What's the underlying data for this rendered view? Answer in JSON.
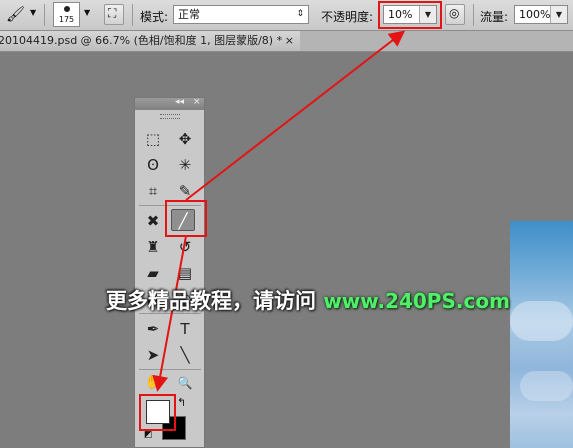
{
  "options_bar": {
    "brush_size": "175",
    "mode_label": "模式:",
    "mode_value": "正常",
    "opacity_label": "不透明度:",
    "opacity_value": "10%",
    "flow_label": "流量:",
    "flow_value": "100%"
  },
  "document_tab": {
    "title": "20104419.psd @ 66.7% (色相/饱和度 1, 图层蒙版/8) *",
    "close": "×"
  },
  "tools_panel": {
    "collapse": "◂◂",
    "close": "×",
    "tools": [
      {
        "name": "marquee",
        "glyph": "⬚"
      },
      {
        "name": "move",
        "glyph": "✥"
      },
      {
        "name": "lasso",
        "glyph": "ʘ"
      },
      {
        "name": "magic-wand",
        "glyph": "✳"
      },
      {
        "name": "crop",
        "glyph": "⌗"
      },
      {
        "name": "eyedropper",
        "glyph": "✎"
      },
      {
        "name": "healing",
        "glyph": "✖"
      },
      {
        "name": "brush",
        "glyph": "╱"
      },
      {
        "name": "stamp",
        "glyph": "♜"
      },
      {
        "name": "history-brush",
        "glyph": "↺"
      },
      {
        "name": "eraser",
        "glyph": "▰"
      },
      {
        "name": "gradient",
        "glyph": "▤"
      },
      {
        "name": "dodge",
        "glyph": "●"
      },
      {
        "name": "blur",
        "glyph": "◐"
      },
      {
        "name": "pen",
        "glyph": "✒"
      },
      {
        "name": "type",
        "glyph": "T"
      },
      {
        "name": "path-select",
        "glyph": "➤"
      },
      {
        "name": "line",
        "glyph": "╲"
      },
      {
        "name": "hand",
        "glyph": "✋"
      },
      {
        "name": "zoom",
        "glyph": "🔍"
      }
    ]
  },
  "watermark": {
    "text": "更多精品教程，请访问 ",
    "url": "www.240PS.com"
  },
  "colors": {
    "highlight": "#e31414",
    "foreground": "#ffffff",
    "background": "#000000"
  }
}
